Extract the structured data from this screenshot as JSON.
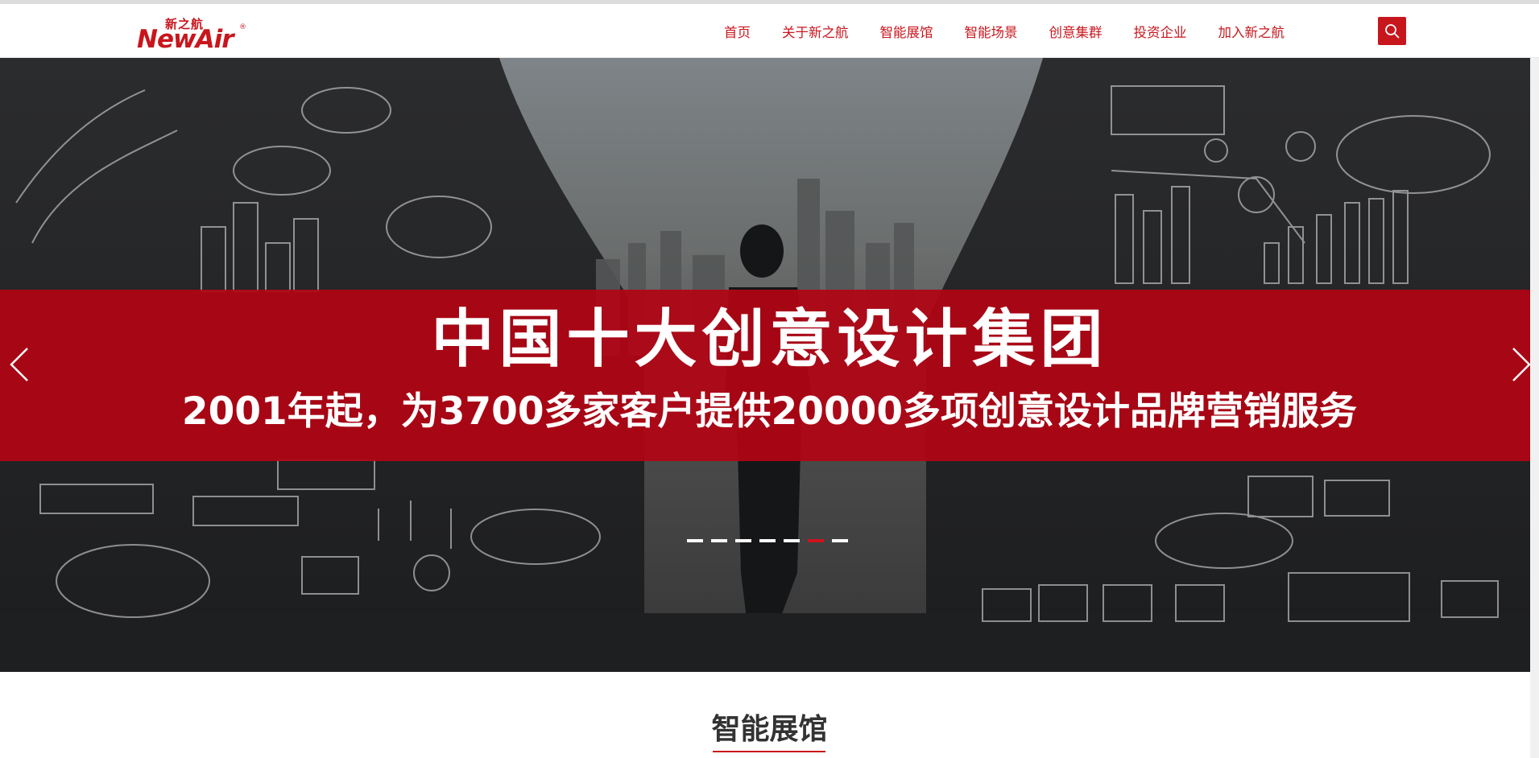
{
  "header": {
    "logo": {
      "cn": "新之航",
      "en": "NewAir",
      "mark": "®"
    },
    "nav": [
      {
        "label": "首页"
      },
      {
        "label": "关于新之航"
      },
      {
        "label": "智能展馆"
      },
      {
        "label": "智能场景"
      },
      {
        "label": "创意集群"
      },
      {
        "label": "投资企业"
      },
      {
        "label": "加入新之航"
      }
    ],
    "search_icon": "search-icon"
  },
  "banner": {
    "headline": "中国十大创意设计集团",
    "subline": "2001年起，为3700多家客户提供20000多项创意设计品牌营销服务",
    "slide_count": 7,
    "active_slide": 6,
    "prev_icon": "chevron-left-icon",
    "next_icon": "chevron-right-icon",
    "strip_color": "#b20414"
  },
  "section": {
    "title": "智能展馆"
  },
  "colors": {
    "brand": "#c8161d"
  }
}
